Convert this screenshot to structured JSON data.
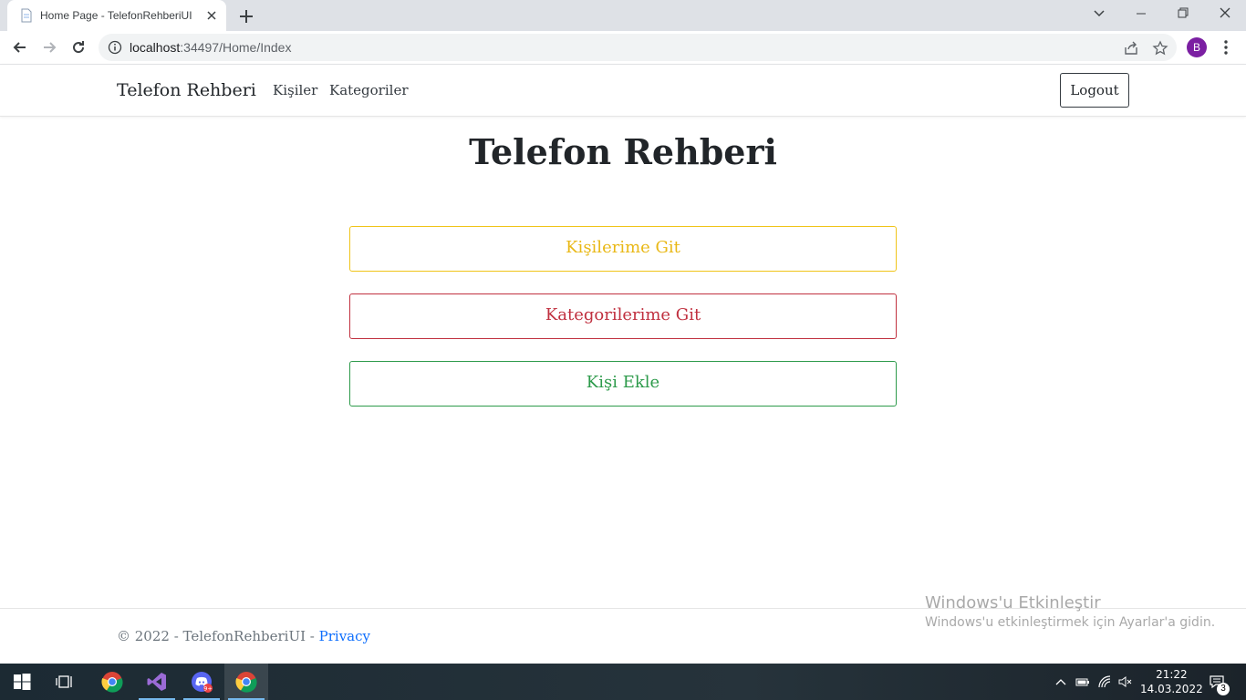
{
  "browser": {
    "tab_title": "Home Page - TelefonRehberiUI",
    "url_host": "localhost",
    "url_rest": ":34497/Home/Index",
    "profile_initial": "B"
  },
  "site": {
    "brand": "Telefon Rehberi",
    "nav": [
      "Kişiler",
      "Kategoriler"
    ],
    "logout_label": "Logout",
    "page_title": "Telefon Rehberi",
    "buttons": {
      "contacts": "Kişilerime Git",
      "categories": "Kategorilerime Git",
      "add_contact": "Kişi Ekle"
    },
    "footer_text": "© 2022 - TelefonRehberiUI - ",
    "footer_link": "Privacy"
  },
  "watermark": {
    "line1": "Windows'u Etkinleştir",
    "line2": "Windows'u etkinleştirmek için Ayarlar'a gidin."
  },
  "taskbar": {
    "time": "21:22",
    "date": "14.03.2022",
    "notification_count": "3",
    "discord_badge": "9+"
  },
  "colors": {
    "warning": "#e9b816",
    "danger": "#c0303f",
    "success": "#2c9a4a",
    "link": "#0d6efd",
    "profile": "#7b1fa2"
  }
}
